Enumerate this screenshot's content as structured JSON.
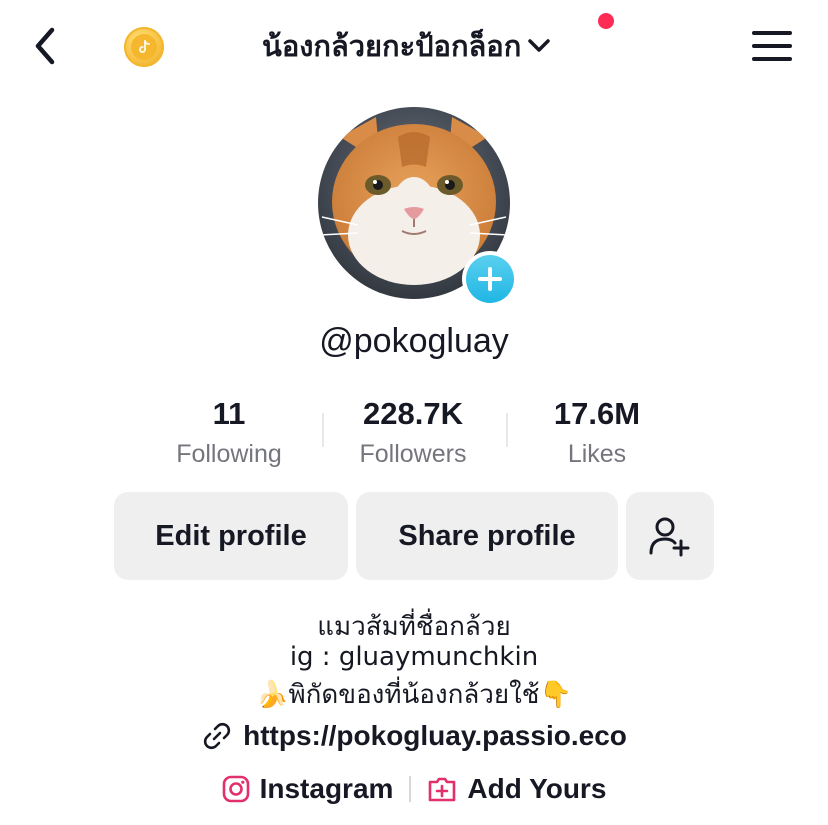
{
  "header": {
    "title": "น้องกล้วยกะป้อกล็อก",
    "has_notification": true,
    "accent_color": "#fe2c55"
  },
  "profile": {
    "username": "@pokogluay"
  },
  "stats": [
    {
      "value": "11",
      "label": "Following"
    },
    {
      "value": "228.7K",
      "label": "Followers"
    },
    {
      "value": "17.6M",
      "label": "Likes"
    }
  ],
  "buttons": {
    "edit": "Edit profile",
    "share": "Share profile"
  },
  "bio": {
    "line1": "แมวส้มที่ชื่อกล้วย",
    "line2": "ig : gluaymunchkin",
    "line3_emoji_left": "🍌",
    "line3_text": "พิกัดของที่น้องกล้วยใช้",
    "line3_emoji_right": "👇"
  },
  "link": {
    "url": "https://pokogluay.passio.eco"
  },
  "social": {
    "instagram": "Instagram",
    "add_yours": "Add Yours"
  }
}
